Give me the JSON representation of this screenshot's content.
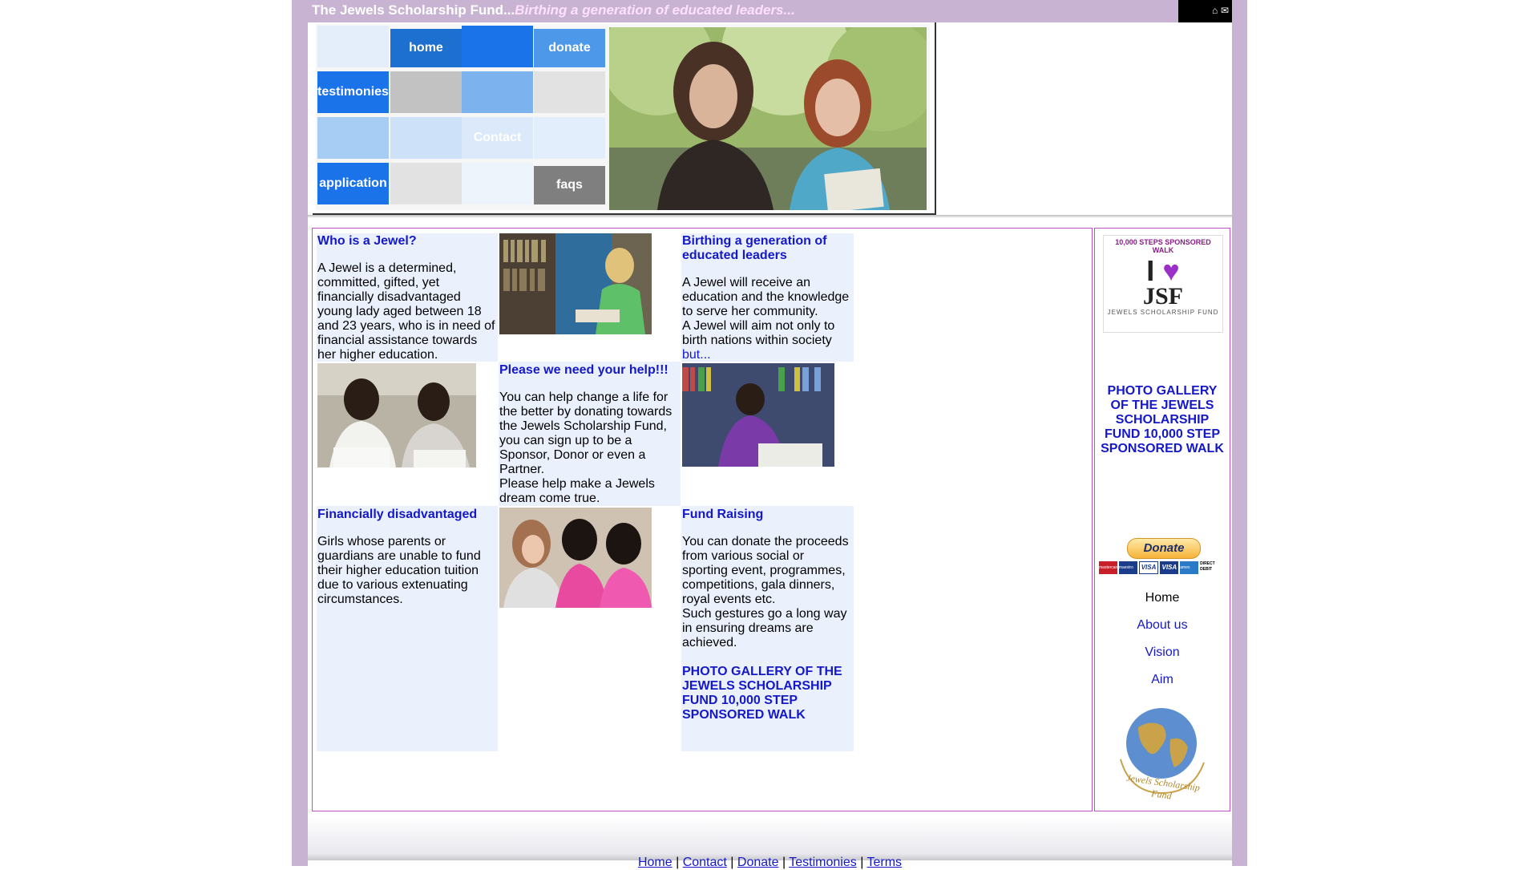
{
  "header": {
    "site_title": "The Jewels Scholarship Fund...",
    "tagline": "Birthing a generation of educated leaders...",
    "icons": [
      "home-icon",
      "mail-icon"
    ]
  },
  "nav": {
    "home": "home",
    "donate": "donate",
    "testimonies": "testimonies",
    "contact": "Contact",
    "application": "application",
    "faqs": "faqs"
  },
  "sections": {
    "who_title": "Who is a Jewel?",
    "who_text": "A Jewel is a determined, committed, gifted, yet financially disadvantaged young lady aged between 18 and 23 years, who is in need of financial assistance towards her higher education.",
    "birthing_title": "Birthing a generation of educated leaders",
    "birthing_text": "A Jewel will receive an education and the knowledge to serve her community.",
    "birthing_text2": "A Jewel will aim not only to birth nations within society",
    "birthing_more": "but...",
    "help_title": "Please we need your help!!!",
    "help_text": "You can help change a life for the better by donating towards the Jewels Scholarship Fund, you can sign up to be a Sponsor, Donor or even a Partner.",
    "help_text2": "Please help make a Jewels dream come true.",
    "fin_title": "Financially disadvantaged",
    "fin_text": "Girls whose parents or guardians are unable to fund their higher education tuition due to various extenuating circumstances.",
    "fund_title": "Fund Raising",
    "fund_text": "You can donate the proceeds from various social or sporting event, programmes, competitions, gala dinners, royal events etc.",
    "fund_text2": "Such gestures go a long way in ensuring dreams are achieved.",
    "gallery_link": "PHOTO GALLERY OF THE JEWELS SCHOLARSHIP FUND 10,000 STEP SPONSORED WALK"
  },
  "sidebar": {
    "walk_banner_top": "10,000 STEPS SPONSORED WALK",
    "walk_banner_i": "I",
    "walk_banner_jsf": "JSF",
    "walk_banner_sub": "JEWELS SCHOLARSHIP FUND",
    "gallery_link": "PHOTO GALLERY OF THE JEWELS SCHOLARSHIP FUND 10,000 STEP SPONSORED WALK",
    "donate_button": "Donate",
    "cards": [
      "mastercard",
      "maestro",
      "VISA",
      "VISA",
      "amex",
      "DIRECT DEBIT"
    ],
    "links": [
      "Home",
      "About us",
      "Vision",
      "Aim"
    ],
    "logo_text": "Jewels Scholarship Fund"
  },
  "footer": {
    "links": [
      "Home",
      "Contact",
      "Donate",
      "Testimonies",
      "Terms"
    ],
    "separator": "|"
  },
  "colors": {
    "outer_bg": "#c8b4d2",
    "link_blue": "#1418c8",
    "nav_blue": "#1a73e8",
    "border_purple": "#c14fc8"
  }
}
